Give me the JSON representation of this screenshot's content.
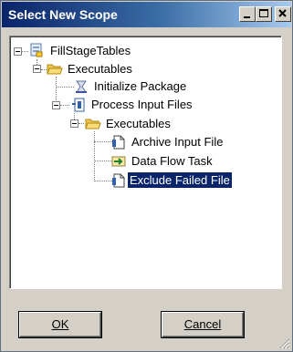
{
  "window": {
    "title": "Select New Scope"
  },
  "tree": {
    "root": {
      "label": "FillStageTables",
      "icon": "package-icon"
    },
    "executables_1": {
      "label": "Executables",
      "icon": "folder-open-icon"
    },
    "initialize_package": {
      "label": "Initialize Package",
      "icon": "sql-task-icon"
    },
    "process_input_files": {
      "label": "Process Input Files",
      "icon": "foreach-container-icon"
    },
    "executables_2": {
      "label": "Executables",
      "icon": "folder-open-icon"
    },
    "archive_input_file": {
      "label": "Archive Input File",
      "icon": "file-system-task-icon"
    },
    "data_flow_task": {
      "label": "Data Flow Task",
      "icon": "data-flow-icon"
    },
    "exclude_failed_file": {
      "label": "Exclude Failed File",
      "icon": "file-system-task-icon",
      "selected": true
    }
  },
  "buttons": {
    "ok": "OK",
    "cancel": "Cancel"
  },
  "colors": {
    "selection": "#0a246a",
    "title_start": "#0a246a",
    "title_end": "#a6caf0"
  }
}
